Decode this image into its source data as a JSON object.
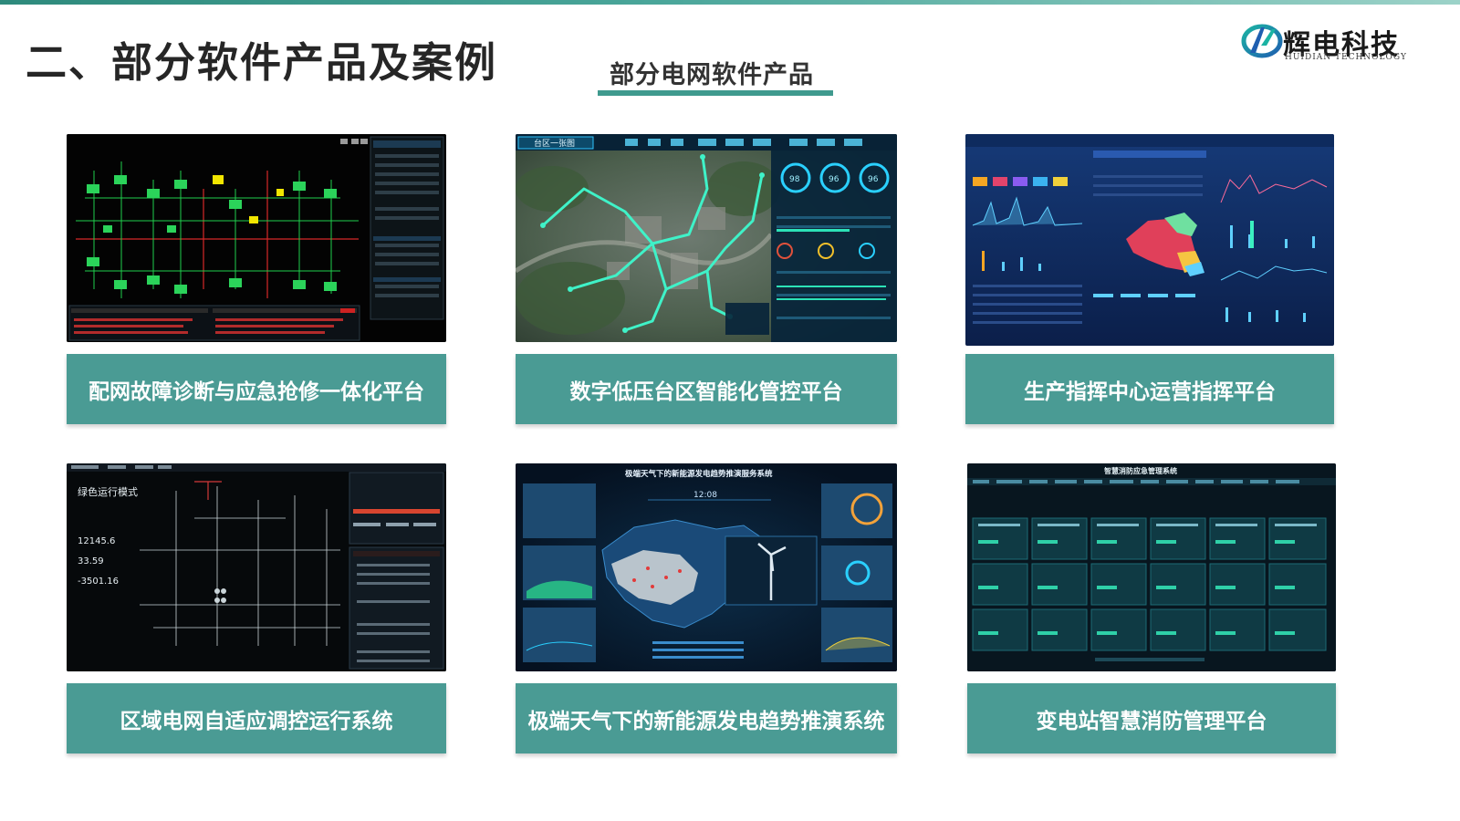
{
  "page": {
    "title": "二、部分软件产品及案例",
    "section_title": "部分电网软件产品"
  },
  "logo": {
    "name_cn": "辉电科技",
    "name_en": "HUIDIAN TECHNOLOGY",
    "icon": "hd-logo-icon"
  },
  "colors": {
    "caption_bg": "#4a9b94",
    "accent": "#3f9a8e",
    "title_text": "#262626"
  },
  "products": [
    {
      "caption": "配网故障诊断与应急抢修一体化平台",
      "screenshot_icon": "grid-topology-screenshot"
    },
    {
      "caption": "数字低压台区智能化管控平台",
      "screenshot_icon": "satellite-map-dashboard-screenshot",
      "screenshot_text": {
        "tab": "台区一张图",
        "gauges": [
          "98",
          "96",
          "96"
        ]
      }
    },
    {
      "caption": "生产指挥中心运营指挥平台",
      "screenshot_icon": "operations-dashboard-screenshot"
    },
    {
      "caption": "区域电网自适应调控运行系统",
      "screenshot_icon": "regional-grid-control-screenshot",
      "screenshot_text": {
        "mode": "绿色运行模式",
        "values": [
          "12145.6",
          "33.59",
          "-3501.16"
        ]
      }
    },
    {
      "caption": "极端天气下的新能源发电趋势推演系统",
      "screenshot_icon": "extreme-weather-forecast-screenshot",
      "screenshot_text": {
        "title": "极端天气下的新能源发电趋势推演服务系统",
        "time": "12:08"
      }
    },
    {
      "caption": "变电站智慧消防管理平台",
      "screenshot_icon": "fire-protection-management-screenshot",
      "screenshot_text": {
        "title": "智慧消防应急管理系统"
      }
    }
  ]
}
